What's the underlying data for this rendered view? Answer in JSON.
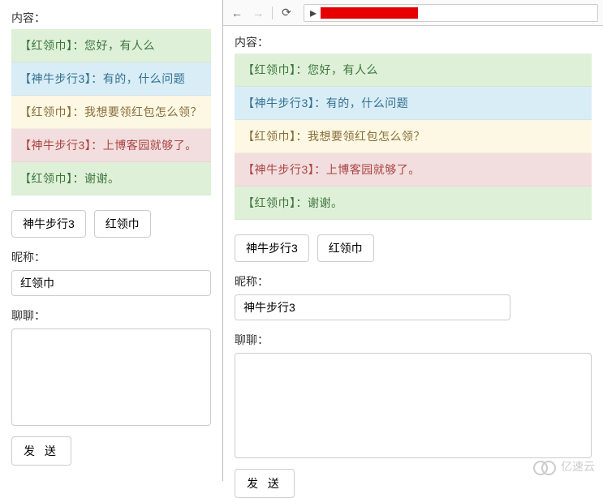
{
  "labels": {
    "content": "内容：",
    "nickname": "昵称：",
    "chat": "聊聊：",
    "send": "发 送"
  },
  "nav": {
    "back_icon": "←",
    "forward_icon": "→",
    "reload_icon": "⟳"
  },
  "messages": [
    {
      "author": "红领巾",
      "text": "您好，有人么",
      "tone": "green"
    },
    {
      "author": "神牛步行3",
      "text": "有的，什么问题",
      "tone": "blue"
    },
    {
      "author": "红领巾",
      "text": "我想要领红包怎么领？",
      "tone": "yellow"
    },
    {
      "author": "神牛步行3",
      "text": "上博客园就够了。",
      "tone": "red"
    },
    {
      "author": "红领巾",
      "text": "谢谢。",
      "tone": "green"
    }
  ],
  "users": [
    "神牛步行3",
    "红领巾"
  ],
  "left": {
    "nickname_value": "红领巾",
    "chat_value": ""
  },
  "right": {
    "nickname_value": "神牛步行3",
    "chat_value": ""
  },
  "watermark": {
    "text": "亿速云"
  }
}
